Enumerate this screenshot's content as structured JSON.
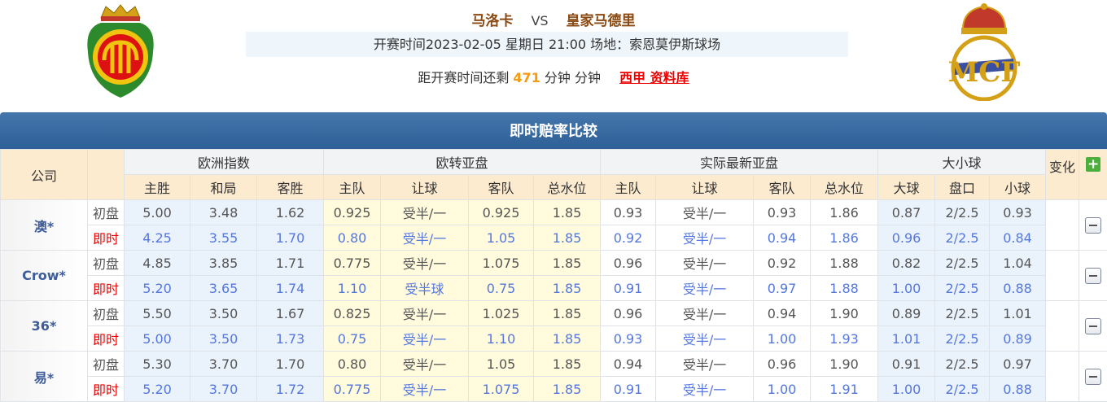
{
  "match": {
    "home": "马洛卡",
    "vs": "VS",
    "away": "皇家马德里",
    "info": "开赛时间2023-02-05 星期日 21:00  场地：索恩莫伊斯球场",
    "countdown_prefix": "距开赛时间还剩",
    "countdown_minutes": "471",
    "countdown_suffix": "分钟 分钟",
    "league_link": "西甲 资料库"
  },
  "band_title": "即时赔率比较",
  "headers": {
    "company": "公司",
    "groups": [
      "欧洲指数",
      "欧转亚盘",
      "实际最新亚盘",
      "大小球"
    ],
    "change": "变化",
    "columns": [
      "主胜",
      "和局",
      "客胜",
      "主队",
      "让球",
      "客队",
      "总水位",
      "主队",
      "让球",
      "客队",
      "总水位",
      "大球",
      "盘口",
      "小球"
    ]
  },
  "row_labels": {
    "init": "初盘",
    "live": "即时"
  },
  "companies": [
    {
      "name": "澳*",
      "init": [
        "5.00",
        "3.48",
        "1.62",
        "0.925",
        "受半/一",
        "0.925",
        "1.85",
        "0.93",
        "受半/一",
        "0.93",
        "1.86",
        "0.87",
        "2/2.5",
        "0.93"
      ],
      "live": [
        "4.25",
        "3.55",
        "1.70",
        "0.80",
        "受半/一",
        "1.05",
        "1.85",
        "0.92",
        "受半/一",
        "0.94",
        "1.86",
        "0.96",
        "2/2.5",
        "0.84"
      ]
    },
    {
      "name": "Crow*",
      "init": [
        "4.85",
        "3.85",
        "1.71",
        "0.775",
        "受半/一",
        "1.075",
        "1.85",
        "0.96",
        "受半/一",
        "0.92",
        "1.88",
        "0.82",
        "2/2.5",
        "1.04"
      ],
      "live": [
        "5.20",
        "3.65",
        "1.74",
        "1.10",
        "受半球",
        "0.75",
        "1.85",
        "0.91",
        "受半/一",
        "0.97",
        "1.88",
        "1.00",
        "2/2.5",
        "0.88"
      ]
    },
    {
      "name": "36*",
      "init": [
        "5.50",
        "3.50",
        "1.67",
        "0.825",
        "受半/一",
        "1.025",
        "1.85",
        "0.96",
        "受半/一",
        "0.94",
        "1.90",
        "0.89",
        "2/2.5",
        "1.01"
      ],
      "live": [
        "5.00",
        "3.50",
        "1.73",
        "0.75",
        "受半/一",
        "1.10",
        "1.85",
        "0.93",
        "受半/一",
        "1.00",
        "1.93",
        "1.01",
        "2/2.5",
        "0.89"
      ]
    },
    {
      "name": "易*",
      "init": [
        "5.30",
        "3.70",
        "1.70",
        "0.80",
        "受半/一",
        "1.05",
        "1.85",
        "0.94",
        "受半/一",
        "0.96",
        "1.90",
        "0.91",
        "2/2.5",
        "0.97"
      ],
      "live": [
        "5.20",
        "3.70",
        "1.72",
        "0.775",
        "受半/一",
        "1.075",
        "1.85",
        "0.91",
        "受半/一",
        "1.00",
        "1.91",
        "1.00",
        "2/2.5",
        "0.88"
      ]
    }
  ],
  "icons": {
    "expand": "plus-icon",
    "collapse": "minus-icon"
  },
  "colors": {
    "band": "#2e5f96",
    "live_value": "#5577dd",
    "live_label": "#ee0000",
    "team": "#8a4a12",
    "countdown": "#f39c12"
  }
}
